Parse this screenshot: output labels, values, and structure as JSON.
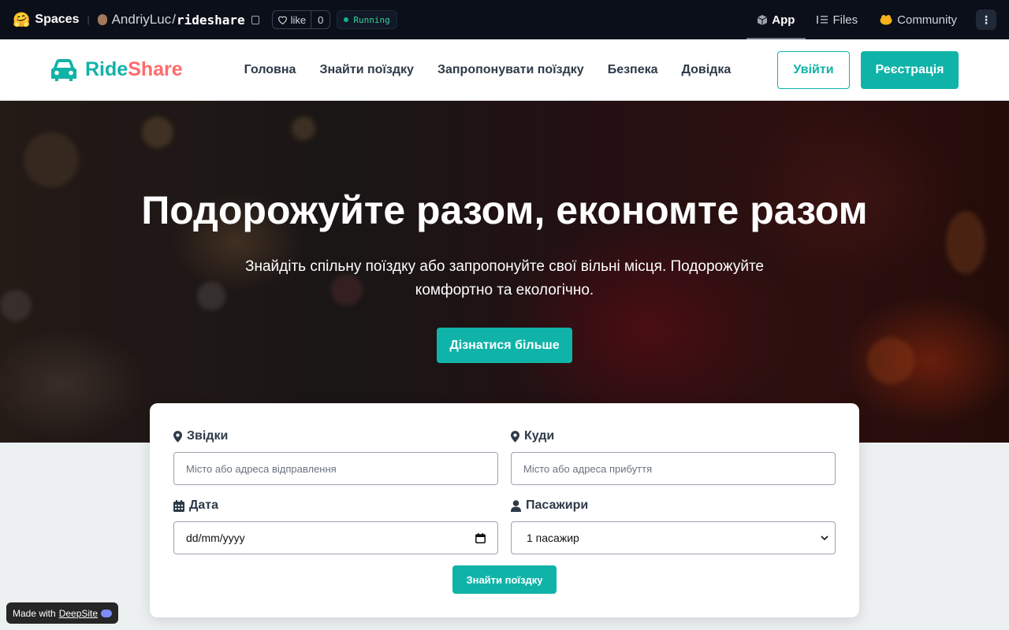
{
  "hf_bar": {
    "spaces_label": "Spaces",
    "owner": "AndriyLuc",
    "repo": "rideshare",
    "like_label": "like",
    "like_count": "0",
    "status": "Running",
    "tabs": [
      {
        "label": "App",
        "icon": "cube-icon"
      },
      {
        "label": "Files",
        "icon": "files-icon"
      },
      {
        "label": "Community",
        "icon": "community-icon"
      }
    ]
  },
  "header": {
    "brand_part1": "Ride",
    "brand_part2": "Share",
    "nav": [
      "Головна",
      "Знайти поїздку",
      "Запропонувати поїздку",
      "Безпека",
      "Довідка"
    ],
    "login_label": "Увійти",
    "register_label": "Реєстрація"
  },
  "hero": {
    "title": "Подорожуйте разом, економте разом",
    "subtitle": "Знайдіть спільну поїздку або запропонуйте свої вільні місця. Подорожуйте комфортно та екологічно.",
    "cta_label": "Дізнатися більше"
  },
  "search": {
    "from_label": "Звідки",
    "from_placeholder": "Місто або адреса відправлення",
    "to_label": "Куди",
    "to_placeholder": "Місто або адреса прибуття",
    "date_label": "Дата",
    "date_value": "dd/mm/yyyy",
    "passengers_label": "Пасажири",
    "passengers_value": "1 пасажир",
    "submit_label": "Знайти поїздку"
  },
  "badge": {
    "prefix": "Made with",
    "link": "DeepSite"
  },
  "colors": {
    "accent": "#10b3a8",
    "brand_secondary": "#ff6b6b",
    "hf_bar": "#0b0f19",
    "page_bg": "#edf0f1"
  }
}
